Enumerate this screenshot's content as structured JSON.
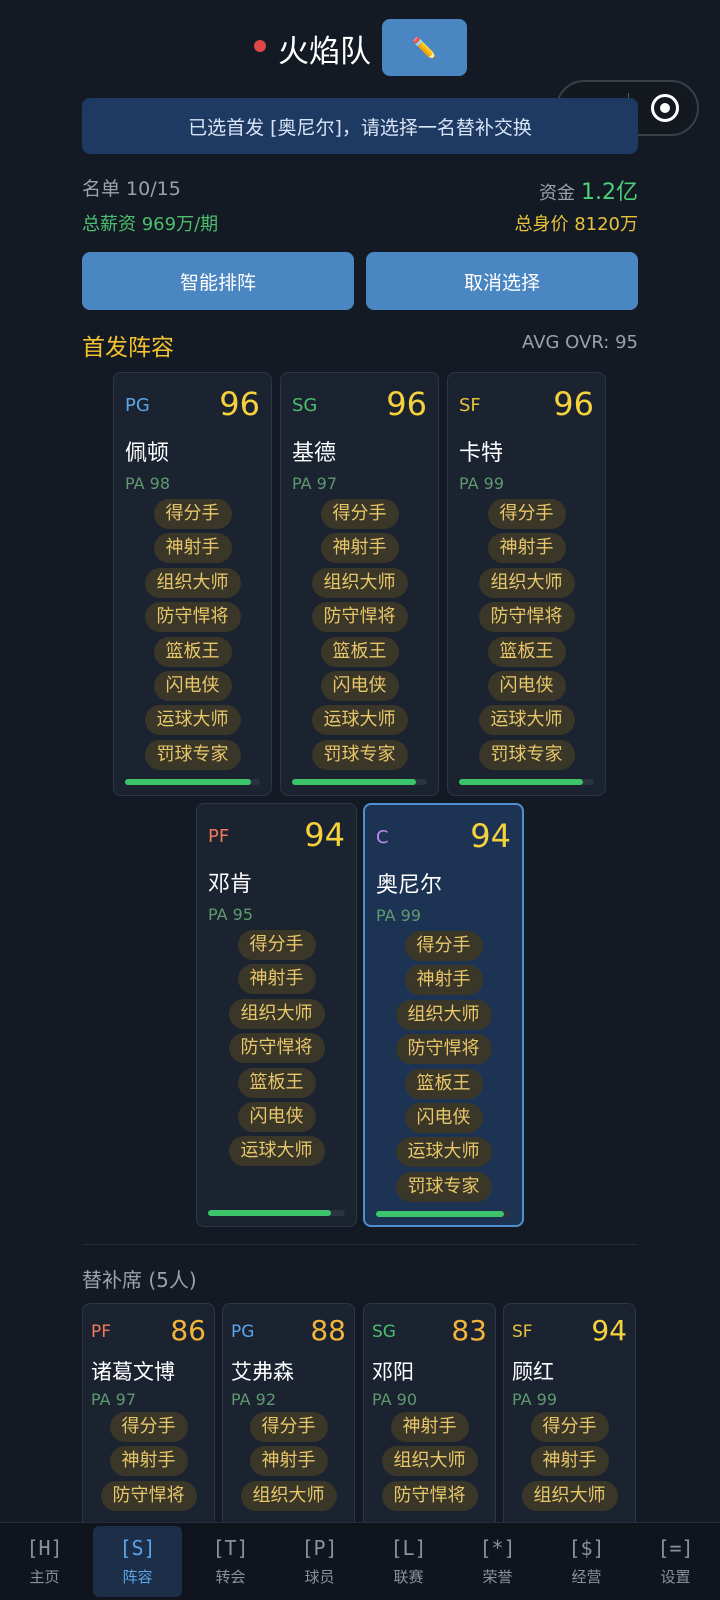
{
  "header": {
    "team_name": "火焰队",
    "edit_icon": "✏️"
  },
  "notice": "已选首发 [奥尼尔]，请选择一名替补交换",
  "summary": {
    "roster": "名单 10/15",
    "funds_label": "资金",
    "funds_value": "1.2亿",
    "salary": "总薪资 969万/期",
    "value": "总身价 8120万"
  },
  "buttons": {
    "auto_lineup": "智能排阵",
    "cancel_selection": "取消选择"
  },
  "starters": {
    "title": "首发阵容",
    "avg": "AVG OVR: 95",
    "players": [
      {
        "pos": "PG",
        "pos_color": "#5aa5ea",
        "ovr": "96",
        "name": "佩顿",
        "pa": "PA 98",
        "tags": [
          "得分手",
          "神射手",
          "组织大师",
          "防守悍将",
          "篮板王",
          "闪电侠",
          "运球大师",
          "罚球专家"
        ],
        "fill": 0.93,
        "selected": false
      },
      {
        "pos": "SG",
        "pos_color": "#4cbe6e",
        "ovr": "96",
        "name": "基德",
        "pa": "PA 97",
        "tags": [
          "得分手",
          "神射手",
          "组织大师",
          "防守悍将",
          "篮板王",
          "闪电侠",
          "运球大师",
          "罚球专家"
        ],
        "fill": 0.92,
        "selected": false
      },
      {
        "pos": "SF",
        "pos_color": "#e8c23a",
        "ovr": "96",
        "name": "卡特",
        "pa": "PA 99",
        "tags": [
          "得分手",
          "神射手",
          "组织大师",
          "防守悍将",
          "篮板王",
          "闪电侠",
          "运球大师",
          "罚球专家"
        ],
        "fill": 0.92,
        "selected": false
      },
      {
        "pos": "PF",
        "pos_color": "#f07a5c",
        "ovr": "94",
        "name": "邓肯",
        "pa": "PA 95",
        "tags": [
          "得分手",
          "神射手",
          "组织大师",
          "防守悍将",
          "篮板王",
          "闪电侠",
          "运球大师"
        ],
        "fill": 0.9,
        "selected": false
      },
      {
        "pos": "C",
        "pos_color": "#b98ae8",
        "ovr": "94",
        "name": "奥尼尔",
        "pa": "PA 99",
        "tags": [
          "得分手",
          "神射手",
          "组织大师",
          "防守悍将",
          "篮板王",
          "闪电侠",
          "运球大师",
          "罚球专家"
        ],
        "fill": 0.95,
        "selected": true
      }
    ]
  },
  "bench": {
    "title": "替补席 (5人)",
    "players": [
      {
        "pos": "PF",
        "pos_color": "#f07a5c",
        "ovr": "86",
        "ovr_color": "#f2b43a",
        "name": "诸葛文博",
        "pa": "PA 97",
        "tags": [
          "得分手",
          "神射手",
          "防守悍将"
        ]
      },
      {
        "pos": "PG",
        "pos_color": "#5aa5ea",
        "ovr": "88",
        "ovr_color": "#f2b43a",
        "name": "艾弗森",
        "pa": "PA 92",
        "tags": [
          "得分手",
          "神射手",
          "组织大师"
        ]
      },
      {
        "pos": "SG",
        "pos_color": "#4cbe6e",
        "ovr": "83",
        "ovr_color": "#f2b43a",
        "name": "邓阳",
        "pa": "PA 90",
        "tags": [
          "神射手",
          "组织大师",
          "防守悍将"
        ]
      },
      {
        "pos": "SF",
        "pos_color": "#e8c23a",
        "ovr": "94",
        "ovr_color": "#f5d23c",
        "name": "顾红",
        "pa": "PA 99",
        "tags": [
          "得分手",
          "神射手",
          "组织大师"
        ]
      }
    ]
  },
  "nav": [
    {
      "icon": "[H]",
      "label": "主页",
      "active": false
    },
    {
      "icon": "[S]",
      "label": "阵容",
      "active": true
    },
    {
      "icon": "[T]",
      "label": "转会",
      "active": false
    },
    {
      "icon": "[P]",
      "label": "球员",
      "active": false
    },
    {
      "icon": "[L]",
      "label": "联赛",
      "active": false
    },
    {
      "icon": "[*]",
      "label": "荣誉",
      "active": false
    },
    {
      "icon": "[$]",
      "label": "经营",
      "active": false
    },
    {
      "icon": "[=]",
      "label": "设置",
      "active": false
    }
  ]
}
